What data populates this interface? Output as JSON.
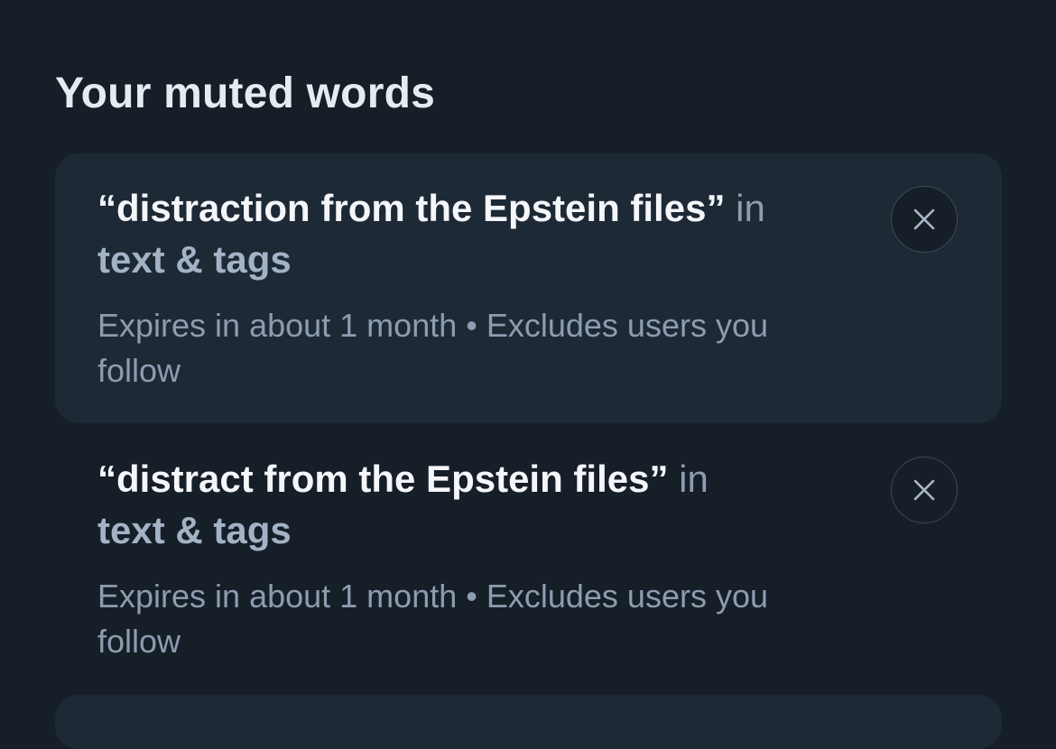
{
  "section": {
    "title": "Your muted words"
  },
  "muted_words": [
    {
      "phrase": "“distraction from the Epstein files”",
      "in_text": "in",
      "scope": "text & tags",
      "meta": "Expires in about 1 month • Excludes users you follow",
      "remove_icon": "close-icon"
    },
    {
      "phrase": "“distract from the Epstein files”",
      "in_text": "in",
      "scope": "text & tags",
      "meta": "Expires in about 1 month • Excludes users you follow",
      "remove_icon": "close-icon"
    }
  ],
  "colors": {
    "background": "#161e27",
    "card_highlight": "#1e2936",
    "title_text": "#e6ebf2",
    "phrase_text": "#f4f6f9",
    "scope_text": "#a3b2c5",
    "secondary_text": "#8d9cb0",
    "button_border": "#3c4a5a"
  }
}
